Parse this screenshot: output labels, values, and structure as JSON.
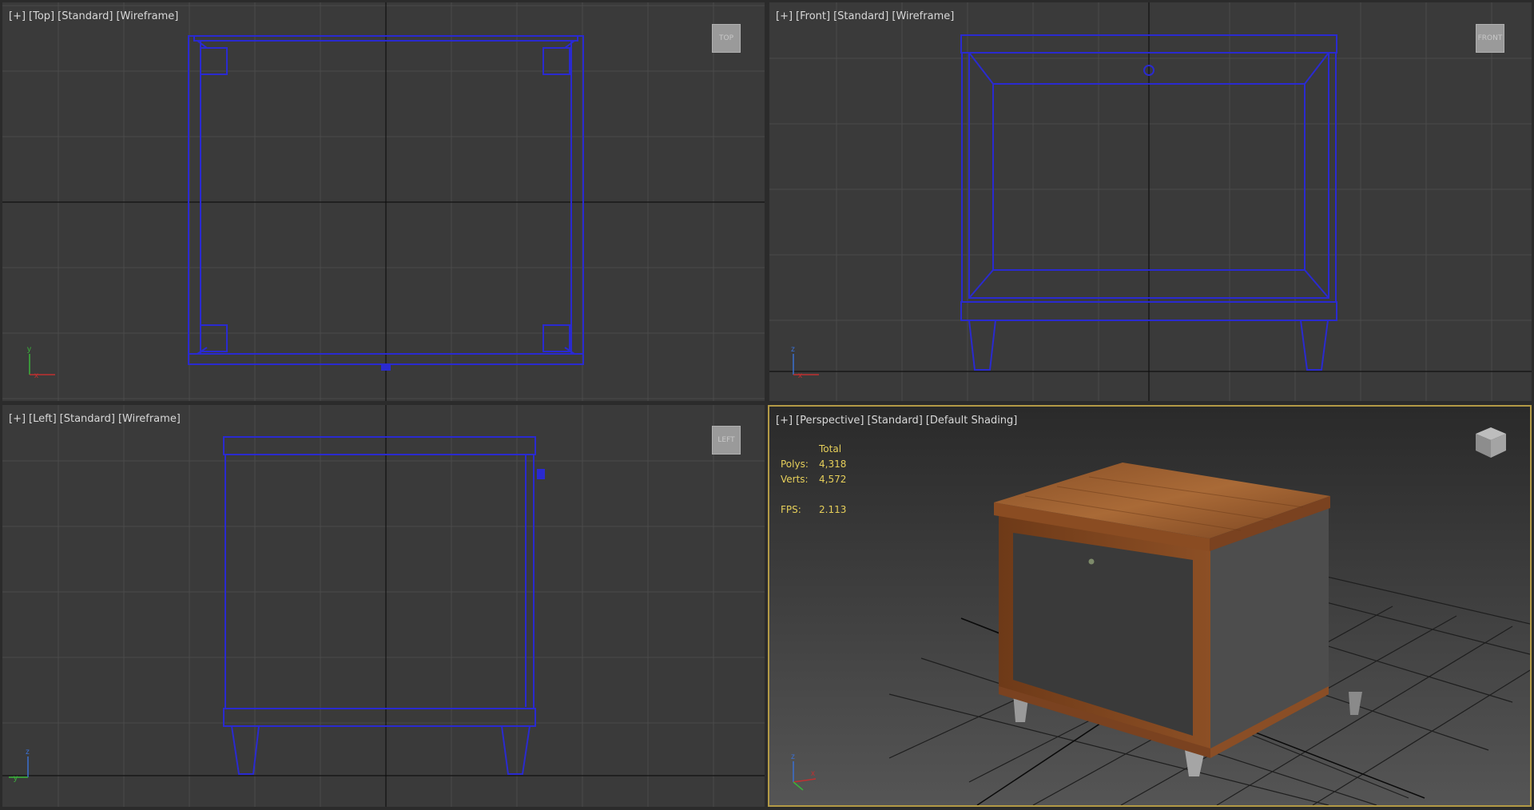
{
  "viewports": {
    "top": {
      "label": [
        "[+]",
        "[Top]",
        "[Standard]",
        "[Wireframe]"
      ],
      "nav": "TOP"
    },
    "front": {
      "label": [
        "[+]",
        "[Front]",
        "[Standard]",
        "[Wireframe]"
      ],
      "nav": "FRONT"
    },
    "left": {
      "label": [
        "[+]",
        "[Left]",
        "[Standard]",
        "[Wireframe]"
      ],
      "nav": "LEFT"
    },
    "persp": {
      "label": [
        "[+]",
        "[Perspective]",
        "[Standard]",
        "[Default Shading]"
      ]
    }
  },
  "axes": {
    "top": [
      "y",
      "x"
    ],
    "front": [
      "z",
      "x"
    ],
    "left": [
      "z",
      "y"
    ],
    "persp": [
      "z",
      "x"
    ]
  },
  "stats": {
    "header": "Total",
    "polys_label": "Polys:",
    "polys": "4,318",
    "verts_label": "Verts:",
    "verts": "4,572",
    "fps_label": "FPS:",
    "fps": "2.113"
  },
  "colors": {
    "wire": "#2a2ad0",
    "grid": "#4a4a4a",
    "active_border": "#b39a46",
    "stats": "#e6cf5a"
  }
}
